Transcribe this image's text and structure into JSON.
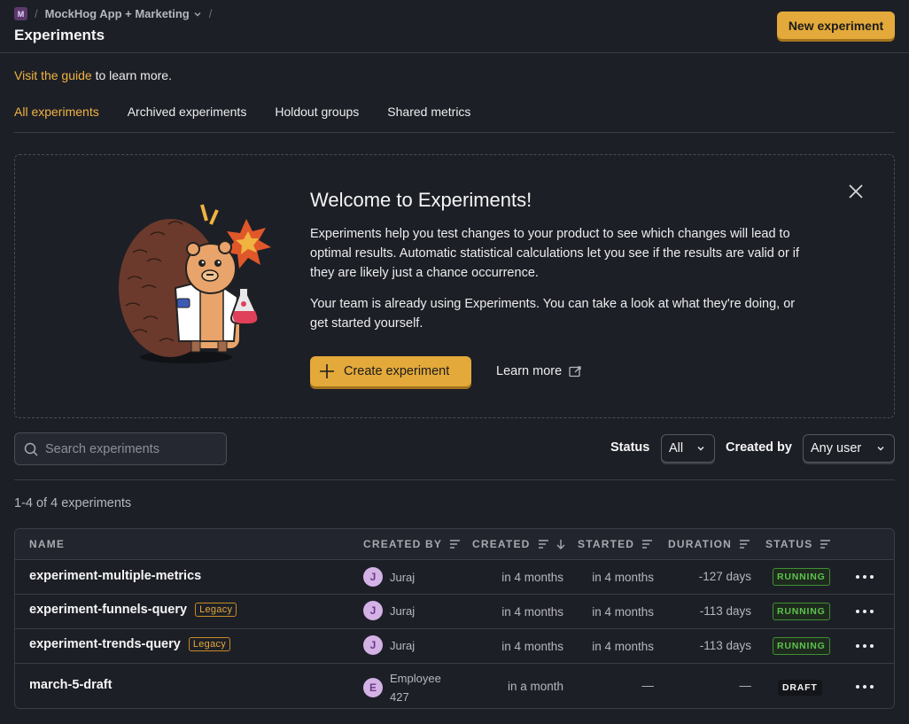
{
  "header": {
    "project_badge": "M",
    "separator": "/",
    "project_name": "MockHog App + Marketing",
    "page_title": "Experiments",
    "new_button": "New experiment"
  },
  "guide": {
    "link": "Visit the guide",
    "rest": "to learn more."
  },
  "tabs": [
    {
      "label": "All experiments",
      "active": true
    },
    {
      "label": "Archived experiments"
    },
    {
      "label": "Holdout groups"
    },
    {
      "label": "Shared metrics"
    }
  ],
  "welcome": {
    "title": "Welcome to Experiments!",
    "p1": "Experiments help you test changes to your product to see which changes will lead to optimal results. Automatic statistical calculations let you see if the results are valid or if they are likely just a chance occurrence.",
    "p2": "Your team is already using Experiments. You can take a look at what they're doing, or get started yourself.",
    "create_button": "Create experiment",
    "learn_more": "Learn more"
  },
  "filters": {
    "search_placeholder": "Search experiments",
    "status_label": "Status",
    "status_value": "All",
    "created_by_label": "Created by",
    "created_by_value": "Any user"
  },
  "count_text": "1-4 of 4 experiments",
  "table": {
    "columns": [
      "NAME",
      "CREATED BY",
      "CREATED",
      "STARTED",
      "DURATION",
      "STATUS"
    ],
    "rows": [
      {
        "name": "experiment-multiple-metrics",
        "legacy": "",
        "avatar": "J",
        "creator": "Juraj",
        "created": "in 4 months",
        "started": "in 4 months",
        "duration": "-127 days",
        "status": "RUNNING"
      },
      {
        "name": "experiment-funnels-query",
        "legacy": "Legacy",
        "avatar": "J",
        "creator": "Juraj",
        "created": "in 4 months",
        "started": "in 4 months",
        "duration": "-113 days",
        "status": "RUNNING"
      },
      {
        "name": "experiment-trends-query",
        "legacy": "Legacy",
        "avatar": "J",
        "creator": "Juraj",
        "created": "in 4 months",
        "started": "in 4 months",
        "duration": "-113 days",
        "status": "RUNNING"
      },
      {
        "name": "march-5-draft",
        "legacy": "",
        "avatar": "E",
        "creator": "Employee 427",
        "created": "in a month",
        "started": "—",
        "duration": "—",
        "status": "DRAFT"
      }
    ]
  },
  "colors": {
    "accent": "#f0b340",
    "button": "#e3a93a",
    "running": "#5ec24e",
    "background": "#1d1f27"
  }
}
